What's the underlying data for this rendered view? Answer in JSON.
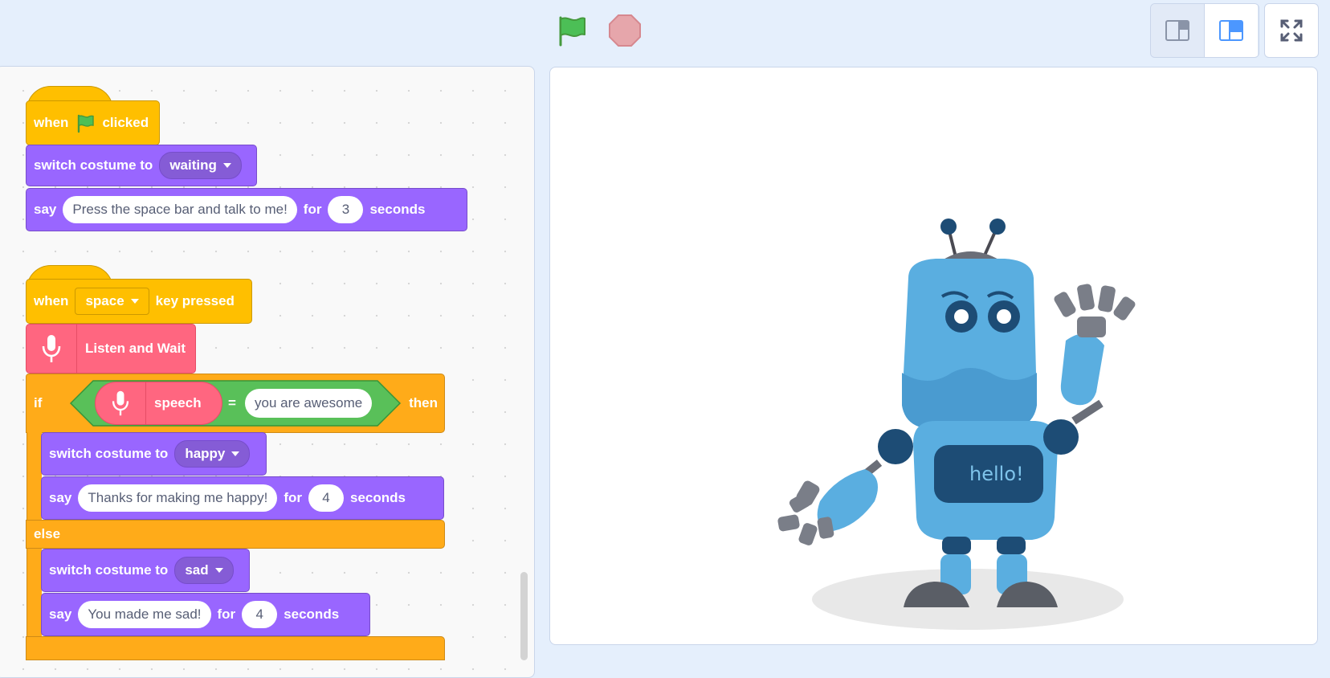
{
  "toolbar": {
    "green_flag": "green-flag-icon",
    "stop": "stop-icon",
    "small_stage": "small-stage-icon",
    "large_stage": "large-stage-icon",
    "fullscreen": "fullscreen-icon"
  },
  "script1": {
    "hat": {
      "when": "when",
      "clicked": "clicked"
    },
    "costume": {
      "label": "switch costume to",
      "value": "waiting"
    },
    "say": {
      "label": "say",
      "text": "Press the space bar and talk to me!",
      "for": "for",
      "secs": "3",
      "seconds": "seconds"
    }
  },
  "script2": {
    "hat": {
      "when": "when",
      "key": "space",
      "pressed": "key pressed"
    },
    "listen": {
      "label": "Listen and Wait"
    },
    "if": {
      "if": "if",
      "speech": "speech",
      "eq": "=",
      "value": "you are awesome",
      "then": "then"
    },
    "happy_costume": {
      "label": "switch costume to",
      "value": "happy"
    },
    "happy_say": {
      "label": "say",
      "text": "Thanks for making me happy!",
      "for": "for",
      "secs": "4",
      "seconds": "seconds"
    },
    "else": "else",
    "sad_costume": {
      "label": "switch costume to",
      "value": "sad"
    },
    "sad_say": {
      "label": "say",
      "text": "You made me sad!",
      "for": "for",
      "secs": "4",
      "seconds": "seconds"
    }
  },
  "stage": {
    "robot_screen_text": "hello!"
  },
  "colors": {
    "events": "#ffbf00",
    "looks": "#9966ff",
    "control": "#ffab19",
    "extension": "#ff6680",
    "operators": "#59c059"
  }
}
